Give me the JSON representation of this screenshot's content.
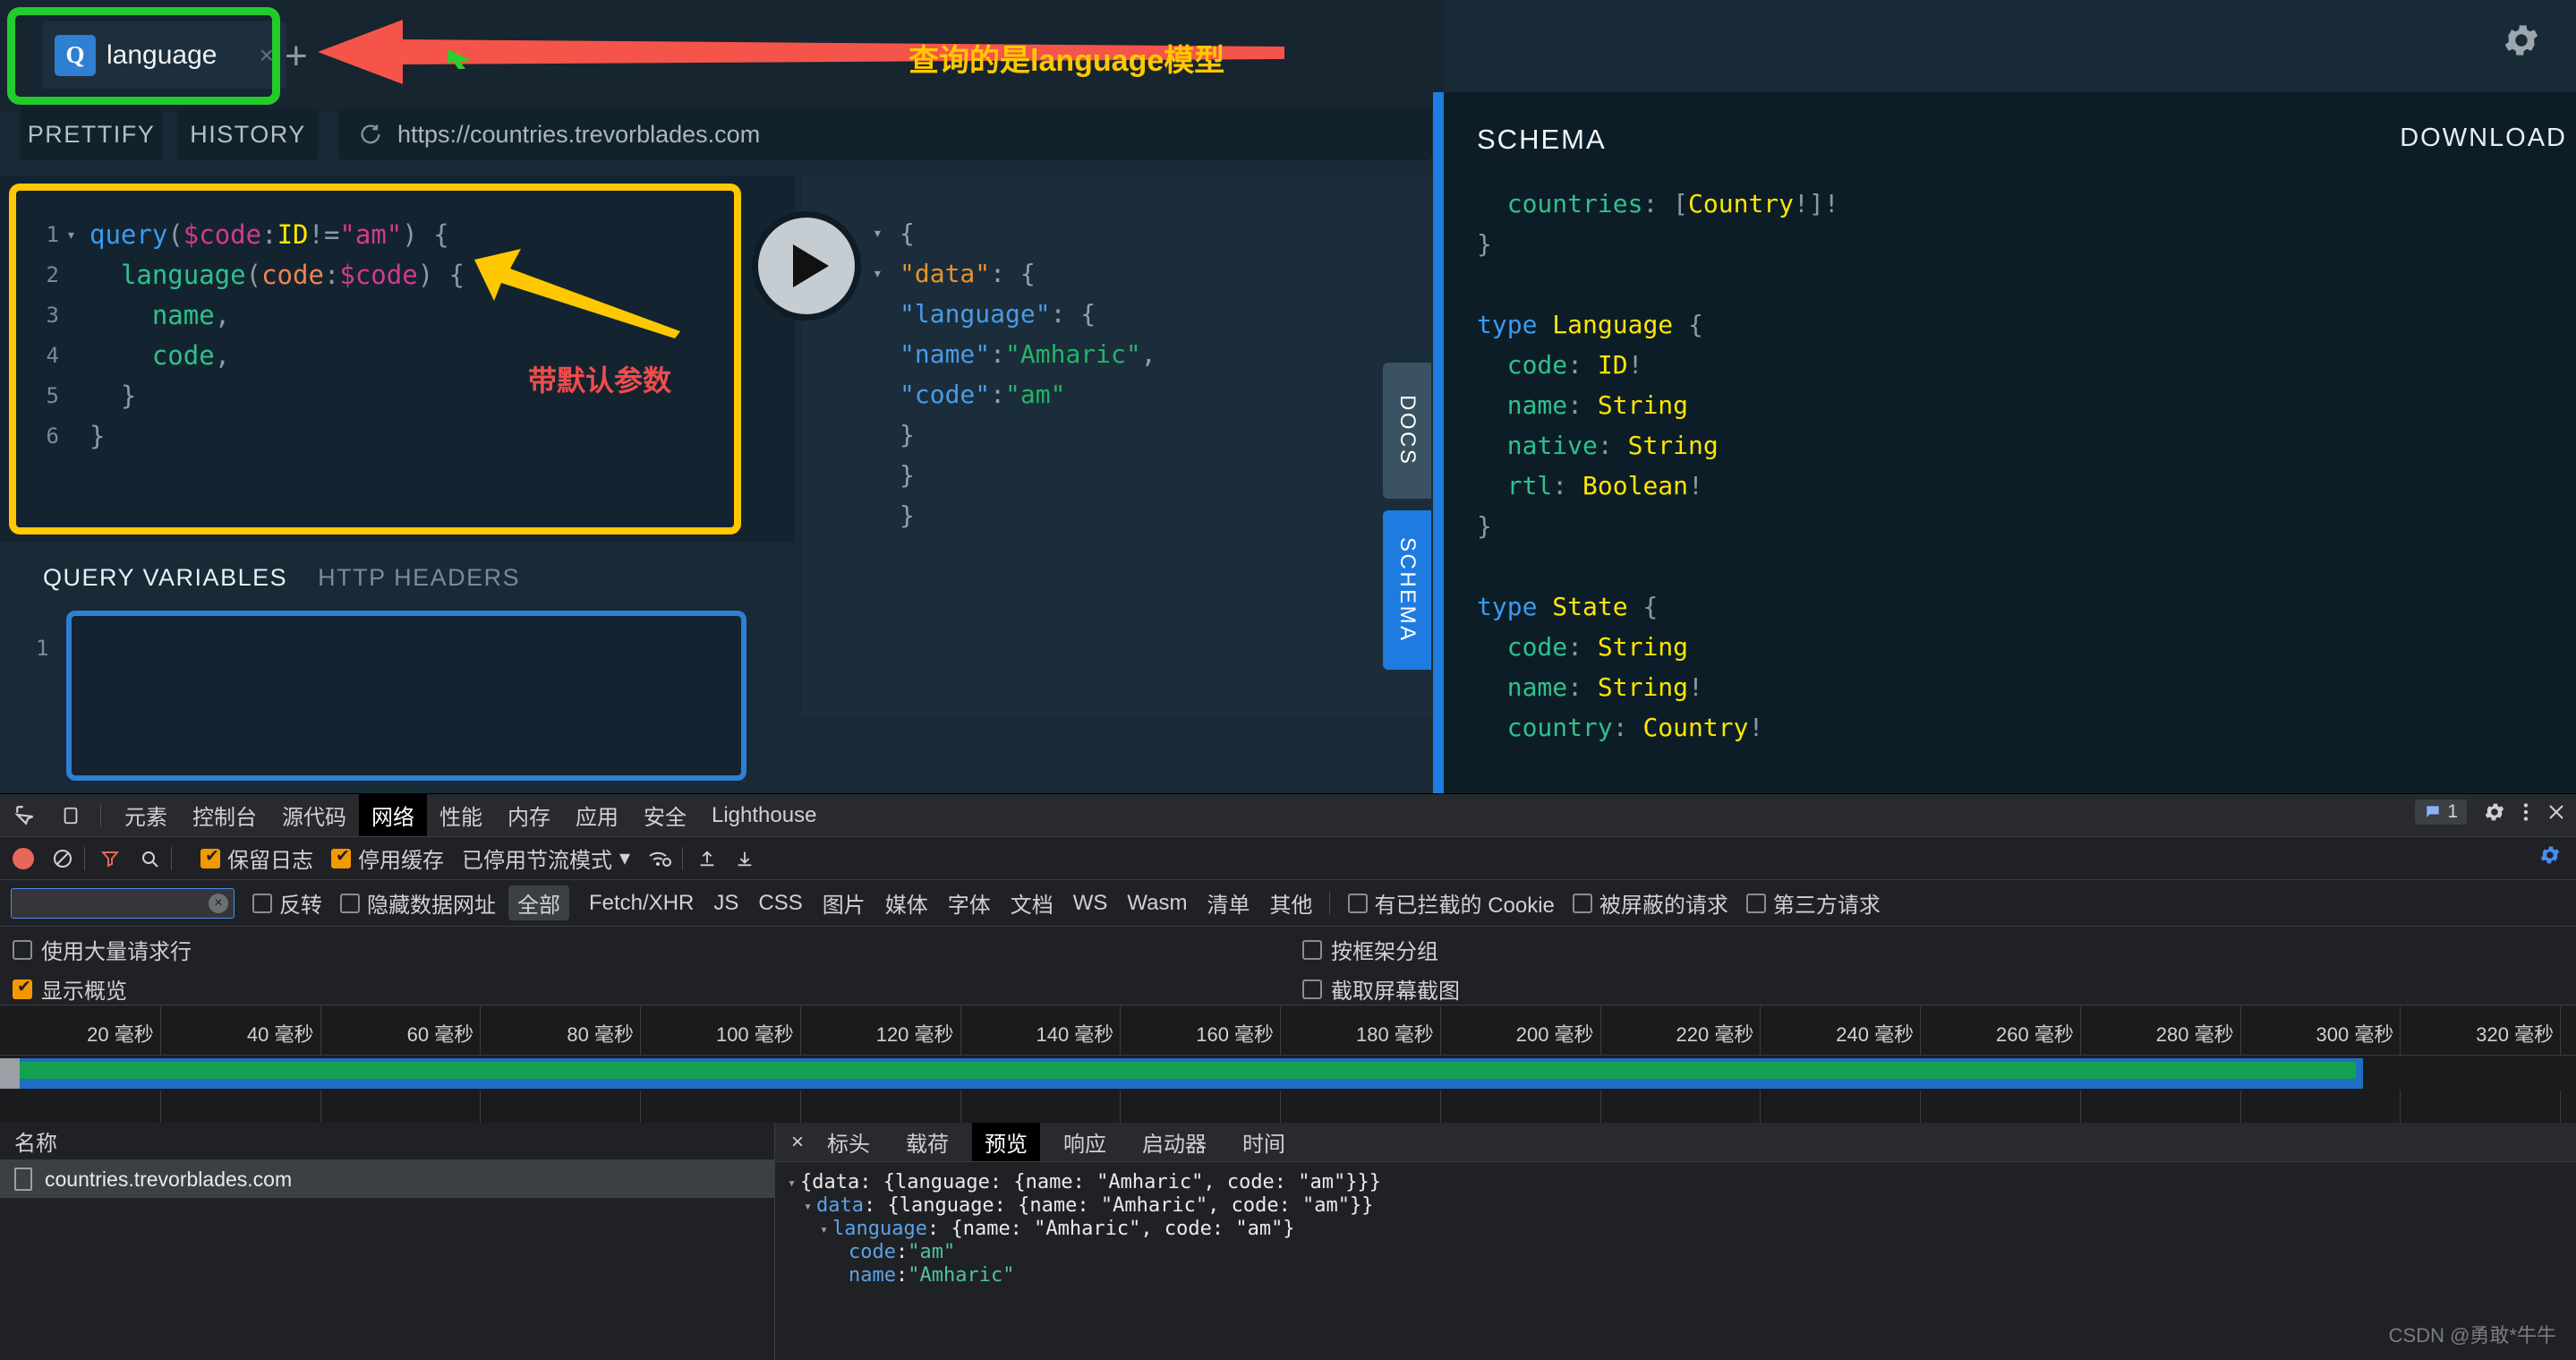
{
  "graphiql": {
    "tab": {
      "badge": "Q",
      "label": "language",
      "close": "×",
      "plus": "+"
    },
    "toolbar": {
      "prettify": "PRETTIFY",
      "history": "HISTORY",
      "url": "https://countries.trevorblades.com",
      "reload_icon": "reload-icon"
    },
    "query_lines": [
      {
        "n": "1",
        "fold": "▾",
        "tokens": [
          {
            "t": "query",
            "c": "t-kw"
          },
          {
            "t": "(",
            "c": "t-punc"
          },
          {
            "t": "$code",
            "c": "t-var"
          },
          {
            "t": ":",
            "c": "t-punc"
          },
          {
            "t": "ID",
            "c": "t-type"
          },
          {
            "t": "!",
            "c": "t-punc"
          },
          {
            "t": "=",
            "c": "t-punc"
          },
          {
            "t": "\"am\"",
            "c": "t-str"
          },
          {
            "t": ")",
            "c": "t-punc"
          },
          {
            "t": " {",
            "c": "t-punc"
          }
        ]
      },
      {
        "n": "2",
        "fold": "",
        "tokens": [
          {
            "t": "  ",
            "c": "t-punc"
          },
          {
            "t": "language",
            "c": "t-field"
          },
          {
            "t": "(",
            "c": "t-punc"
          },
          {
            "t": "code",
            "c": "t-arg"
          },
          {
            "t": ":",
            "c": "t-punc"
          },
          {
            "t": "$code",
            "c": "t-var"
          },
          {
            "t": ")",
            "c": "t-punc"
          },
          {
            "t": " {",
            "c": "t-punc"
          }
        ]
      },
      {
        "n": "3",
        "fold": "",
        "tokens": [
          {
            "t": "    ",
            "c": "t-punc"
          },
          {
            "t": "name",
            "c": "t-field"
          },
          {
            "t": ",",
            "c": "t-punc"
          }
        ]
      },
      {
        "n": "4",
        "fold": "",
        "tokens": [
          {
            "t": "    ",
            "c": "t-punc"
          },
          {
            "t": "code",
            "c": "t-field"
          },
          {
            "t": ",",
            "c": "t-punc"
          }
        ]
      },
      {
        "n": "5",
        "fold": "",
        "tokens": [
          {
            "t": "  ",
            "c": "t-punc"
          },
          {
            "t": "}",
            "c": "t-punc"
          }
        ]
      },
      {
        "n": "6",
        "fold": "",
        "tokens": [
          {
            "t": "}",
            "c": "t-punc"
          }
        ]
      }
    ],
    "variables": {
      "tab_active": "QUERY VARIABLES",
      "tab_inactive": "HTTP HEADERS",
      "linenum": "1",
      "value": ""
    },
    "response_lines": [
      {
        "fold": "▾",
        "tokens": [
          {
            "t": "{",
            "c": "r-punc"
          }
        ]
      },
      {
        "fold": "▾",
        "tokens": [
          {
            "t": "  ",
            "c": "r-punc"
          },
          {
            "t": "\"data\"",
            "c": "r-data"
          },
          {
            "t": ": {",
            "c": "r-punc"
          }
        ]
      },
      {
        "fold": "",
        "tokens": [
          {
            "t": "    ",
            "c": "r-punc"
          },
          {
            "t": "\"language\"",
            "c": "r-key"
          },
          {
            "t": ": {",
            "c": "r-punc"
          }
        ]
      },
      {
        "fold": "",
        "tokens": [
          {
            "t": "      ",
            "c": "r-punc"
          },
          {
            "t": "\"name\"",
            "c": "r-key"
          },
          {
            "t": ": ",
            "c": "r-punc"
          },
          {
            "t": "\"Amharic\"",
            "c": "r-str"
          },
          {
            "t": ",",
            "c": "r-punc"
          }
        ]
      },
      {
        "fold": "",
        "tokens": [
          {
            "t": "      ",
            "c": "r-punc"
          },
          {
            "t": "\"code\"",
            "c": "r-key"
          },
          {
            "t": ": ",
            "c": "r-punc"
          },
          {
            "t": "\"am\"",
            "c": "r-str"
          }
        ]
      },
      {
        "fold": "",
        "tokens": [
          {
            "t": "    }",
            "c": "r-punc"
          }
        ]
      },
      {
        "fold": "",
        "tokens": [
          {
            "t": "  }",
            "c": "r-punc"
          }
        ]
      },
      {
        "fold": "",
        "tokens": [
          {
            "t": "}",
            "c": "r-punc"
          }
        ]
      }
    ],
    "vtabs": {
      "docs": "DOCS",
      "schema": "SCHEMA"
    },
    "schema": {
      "title": "SCHEMA",
      "download": "DOWNLOAD",
      "lines": [
        [
          {
            "t": "  ",
            "c": "s-punc"
          },
          {
            "t": "countries",
            "c": "s-field"
          },
          {
            "t": ": ",
            "c": "s-punc"
          },
          {
            "t": "[",
            "c": "s-punc"
          },
          {
            "t": "Country",
            "c": "s-type"
          },
          {
            "t": "!]!",
            "c": "s-punc"
          }
        ],
        [
          {
            "t": "}",
            "c": "s-punc"
          }
        ],
        [
          {
            "t": "",
            "c": "s-punc"
          }
        ],
        [
          {
            "t": "type ",
            "c": "s-kw"
          },
          {
            "t": "Language",
            "c": "s-type"
          },
          {
            "t": " {",
            "c": "s-punc"
          }
        ],
        [
          {
            "t": "  ",
            "c": "s-punc"
          },
          {
            "t": "code",
            "c": "s-field"
          },
          {
            "t": ": ",
            "c": "s-punc"
          },
          {
            "t": "ID",
            "c": "s-type"
          },
          {
            "t": "!",
            "c": "s-punc"
          }
        ],
        [
          {
            "t": "  ",
            "c": "s-punc"
          },
          {
            "t": "name",
            "c": "s-field"
          },
          {
            "t": ": ",
            "c": "s-punc"
          },
          {
            "t": "String",
            "c": "s-type"
          }
        ],
        [
          {
            "t": "  ",
            "c": "s-punc"
          },
          {
            "t": "native",
            "c": "s-field"
          },
          {
            "t": ": ",
            "c": "s-punc"
          },
          {
            "t": "String",
            "c": "s-type"
          }
        ],
        [
          {
            "t": "  ",
            "c": "s-punc"
          },
          {
            "t": "rtl",
            "c": "s-field"
          },
          {
            "t": ": ",
            "c": "s-punc"
          },
          {
            "t": "Boolean",
            "c": "s-type"
          },
          {
            "t": "!",
            "c": "s-punc"
          }
        ],
        [
          {
            "t": "}",
            "c": "s-punc"
          }
        ],
        [
          {
            "t": "",
            "c": "s-punc"
          }
        ],
        [
          {
            "t": "type ",
            "c": "s-kw"
          },
          {
            "t": "State",
            "c": "s-type"
          },
          {
            "t": " {",
            "c": "s-punc"
          }
        ],
        [
          {
            "t": "  ",
            "c": "s-punc"
          },
          {
            "t": "code",
            "c": "s-field"
          },
          {
            "t": ": ",
            "c": "s-punc"
          },
          {
            "t": "String",
            "c": "s-type"
          }
        ],
        [
          {
            "t": "  ",
            "c": "s-punc"
          },
          {
            "t": "name",
            "c": "s-field"
          },
          {
            "t": ": ",
            "c": "s-punc"
          },
          {
            "t": "String",
            "c": "s-type"
          },
          {
            "t": "!",
            "c": "s-punc"
          }
        ],
        [
          {
            "t": "  ",
            "c": "s-punc"
          },
          {
            "t": "country",
            "c": "s-field"
          },
          {
            "t": ": ",
            "c": "s-punc"
          },
          {
            "t": "Country",
            "c": "s-type"
          },
          {
            "t": "!",
            "c": "s-punc"
          }
        ]
      ]
    },
    "settings_icon": "gear-icon"
  },
  "annotations": {
    "top_text": "查询的是language模型",
    "mid_text": "带默认参数",
    "red_arrow": "left-arrow",
    "yellow_arrow": "up-left-arrow",
    "green_box": "green-highlight-box",
    "yellow_box": "yellow-highlight-box",
    "blue_box": "blue-highlight-box"
  },
  "devtools": {
    "panel_tabs": [
      {
        "label": "元素",
        "active": false
      },
      {
        "label": "控制台",
        "active": false
      },
      {
        "label": "源代码",
        "active": false
      },
      {
        "label": "网络",
        "active": true
      },
      {
        "label": "性能",
        "active": false
      },
      {
        "label": "内存",
        "active": false
      },
      {
        "label": "应用",
        "active": false
      },
      {
        "label": "安全",
        "active": false
      },
      {
        "label": "Lighthouse",
        "active": false
      }
    ],
    "left_icons": [
      "inspect-icon",
      "device-toolbar-icon"
    ],
    "right": {
      "chat_count": "1",
      "gear": "gear-icon",
      "more": "more-vertical-icon",
      "close": "close-icon"
    },
    "toolbar": {
      "record": "record-icon",
      "clear": "clear-icon",
      "filter": "filter-icon",
      "search": "search-icon",
      "preserve_log": "保留日志",
      "preserve_log_checked": true,
      "disable_cache": "停用缓存",
      "disable_cache_checked": true,
      "throttling": "已停用节流模式",
      "throttling_caret": "▾",
      "wifi_icon": "wifi-settings-icon",
      "import_icon": "upload-icon",
      "export_icon": "download-icon",
      "settings_icon": "gear-icon"
    },
    "filter": {
      "input_value": "",
      "clear_icon": "×",
      "invert_label": "反转",
      "invert_checked": false,
      "hide_data_urls_label": "隐藏数据网址",
      "hide_data_urls_checked": false,
      "types": [
        "全部",
        "Fetch/XHR",
        "JS",
        "CSS",
        "图片",
        "媒体",
        "字体",
        "文档",
        "WS",
        "Wasm",
        "清单",
        "其他"
      ],
      "selected_type": "全部",
      "blocked_cookies_label": "有已拦截的 Cookie",
      "blocked_cookies_checked": false,
      "blocked_requests_label": "被屏蔽的请求",
      "blocked_requests_checked": false,
      "third_party_label": "第三方请求",
      "third_party_checked": false
    },
    "options": {
      "big_rows_label": "使用大量请求行",
      "big_rows_checked": false,
      "show_overview_label": "显示概览",
      "show_overview_checked": true,
      "group_by_frame_label": "按框架分组",
      "group_by_frame_checked": false,
      "capture_screenshots_label": "截取屏幕截图",
      "capture_screenshots_checked": false
    },
    "timeline_ticks": [
      "20 毫秒",
      "40 毫秒",
      "60 毫秒",
      "80 毫秒",
      "100 毫秒",
      "120 毫秒",
      "140 毫秒",
      "160 毫秒",
      "180 毫秒",
      "200 毫秒",
      "220 毫秒",
      "240 毫秒",
      "260 毫秒",
      "280 毫秒",
      "300 毫秒",
      "320 毫秒"
    ],
    "requests": {
      "column_name": "名称",
      "rows": [
        {
          "name": "countries.trevorblades.com"
        }
      ]
    },
    "detail": {
      "close": "×",
      "tabs": [
        {
          "label": "标头",
          "active": false
        },
        {
          "label": "载荷",
          "active": false
        },
        {
          "label": "预览",
          "active": true
        },
        {
          "label": "响应",
          "active": false
        },
        {
          "label": "启动器",
          "active": false
        },
        {
          "label": "时间",
          "active": false
        }
      ],
      "preview_lines": [
        {
          "indent": 0,
          "fold": "▾",
          "tokens": [
            {
              "t": "{data: {language: {name: \"Amharic\", code: \"am\"}}}",
              "c": ""
            }
          ]
        },
        {
          "indent": 1,
          "fold": "▾",
          "tokens": [
            {
              "t": "data",
              "c": "p-key"
            },
            {
              "t": ": {language: {name: \"Amharic\", code: \"am\"}}",
              "c": ""
            }
          ]
        },
        {
          "indent": 2,
          "fold": "▾",
          "tokens": [
            {
              "t": "language",
              "c": "p-key"
            },
            {
              "t": ": {name: \"Amharic\", code: \"am\"}",
              "c": ""
            }
          ]
        },
        {
          "indent": 3,
          "fold": "",
          "tokens": [
            {
              "t": "code",
              "c": "p-key"
            },
            {
              "t": ": ",
              "c": ""
            },
            {
              "t": "\"am\"",
              "c": "p-str"
            }
          ]
        },
        {
          "indent": 3,
          "fold": "",
          "tokens": [
            {
              "t": "name",
              "c": "p-key"
            },
            {
              "t": ": ",
              "c": ""
            },
            {
              "t": "\"Amharic\"",
              "c": "p-str"
            }
          ]
        }
      ]
    }
  },
  "watermark": "CSDN @勇敢*牛牛"
}
